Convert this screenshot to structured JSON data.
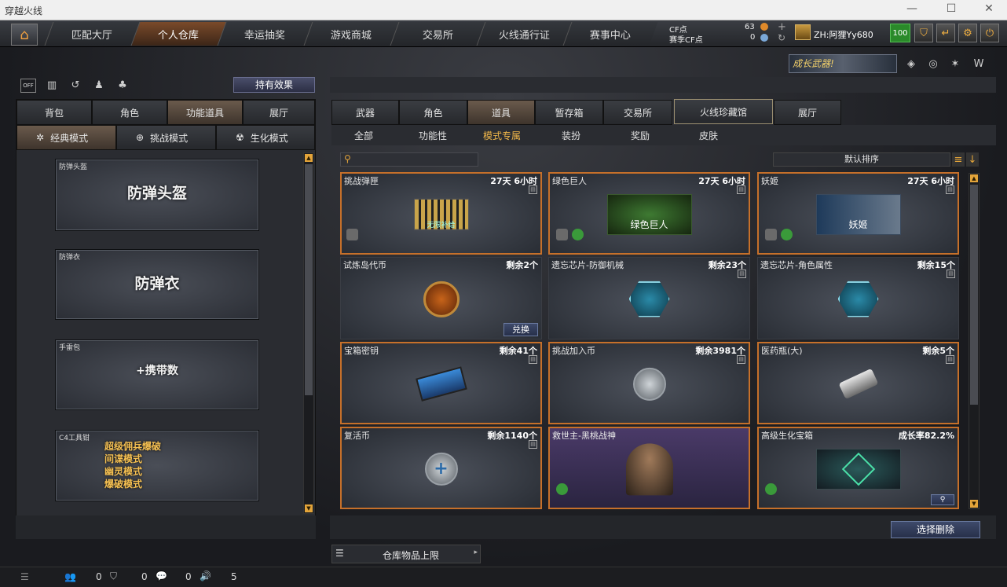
{
  "window": {
    "title": "穿越火线"
  },
  "nav": {
    "tabs": [
      "匹配大厅",
      "个人仓库",
      "幸运抽奖",
      "游戏商城",
      "交易所",
      "火线通行证",
      "赛事中心"
    ],
    "active": 1
  },
  "currency": {
    "cf_label": "CF点",
    "cf_value": "63",
    "event_label": "赛季CF点",
    "event_value": "0"
  },
  "user": {
    "name": "ZH:阿狸Yy680",
    "level": "100"
  },
  "banner": {
    "text": "成长武器!"
  },
  "left": {
    "effect_button": "持有效果",
    "tabs": [
      "背包",
      "角色",
      "功能道具",
      "展厅"
    ],
    "active_tab": 2,
    "modes": [
      "经典模式",
      "挑战模式",
      "生化模式"
    ],
    "items": [
      {
        "label": "防弹头盔",
        "art": "防弹头盔"
      },
      {
        "label": "防弹衣",
        "art": "防弹衣"
      },
      {
        "label": "手雷包",
        "art": "+携带数"
      },
      {
        "label": "C4工具钳",
        "art_lines": [
          "超级佣兵爆破",
          "间谍模式",
          "幽灵模式",
          "爆破模式"
        ]
      }
    ]
  },
  "right": {
    "tabs": [
      "武器",
      "角色",
      "道具",
      "暂存箱",
      "交易所",
      "火线珍藏馆",
      "展厅"
    ],
    "active_tab": 2,
    "cats": [
      "全部",
      "功能性",
      "模式专属",
      "装扮",
      "奖励",
      "皮肤"
    ],
    "active_cat": 2,
    "search_placeholder": "",
    "sort_label": "默认排序",
    "items": [
      {
        "name": "挑战弹匣",
        "right": "27天 6小时",
        "pic_text": "无限补给"
      },
      {
        "name": "绿色巨人",
        "right": "27天 6小时",
        "pic_text": "绿色巨人"
      },
      {
        "name": "妖姬",
        "right": "27天 6小时",
        "pic_text": "妖姬"
      },
      {
        "name": "试炼岛代币",
        "right": "剩余2个",
        "button": "兑换"
      },
      {
        "name": "遗忘芯片-防御机械",
        "right": "剩余23个"
      },
      {
        "name": "遗忘芯片-角色属性",
        "right": "剩余15个"
      },
      {
        "name": "宝箱密钥",
        "right": "剩余41个"
      },
      {
        "name": "挑战加入币",
        "right": "剩余3981个"
      },
      {
        "name": "医药瓶(大)",
        "right": "剩余5个"
      },
      {
        "name": "复活币",
        "right": "剩余1140个"
      },
      {
        "name": "救世主-黑桃战神",
        "right": ""
      },
      {
        "name": "高级生化宝箱",
        "right": "成长率82.2%"
      }
    ],
    "delete_button": "选择删除",
    "capacity_label": "仓库物品上限"
  },
  "bottom": {
    "counts": [
      "0",
      "0",
      "0",
      "5"
    ]
  },
  "colors": {
    "accent": "#c6702a",
    "highlight": "#f2b84a"
  }
}
